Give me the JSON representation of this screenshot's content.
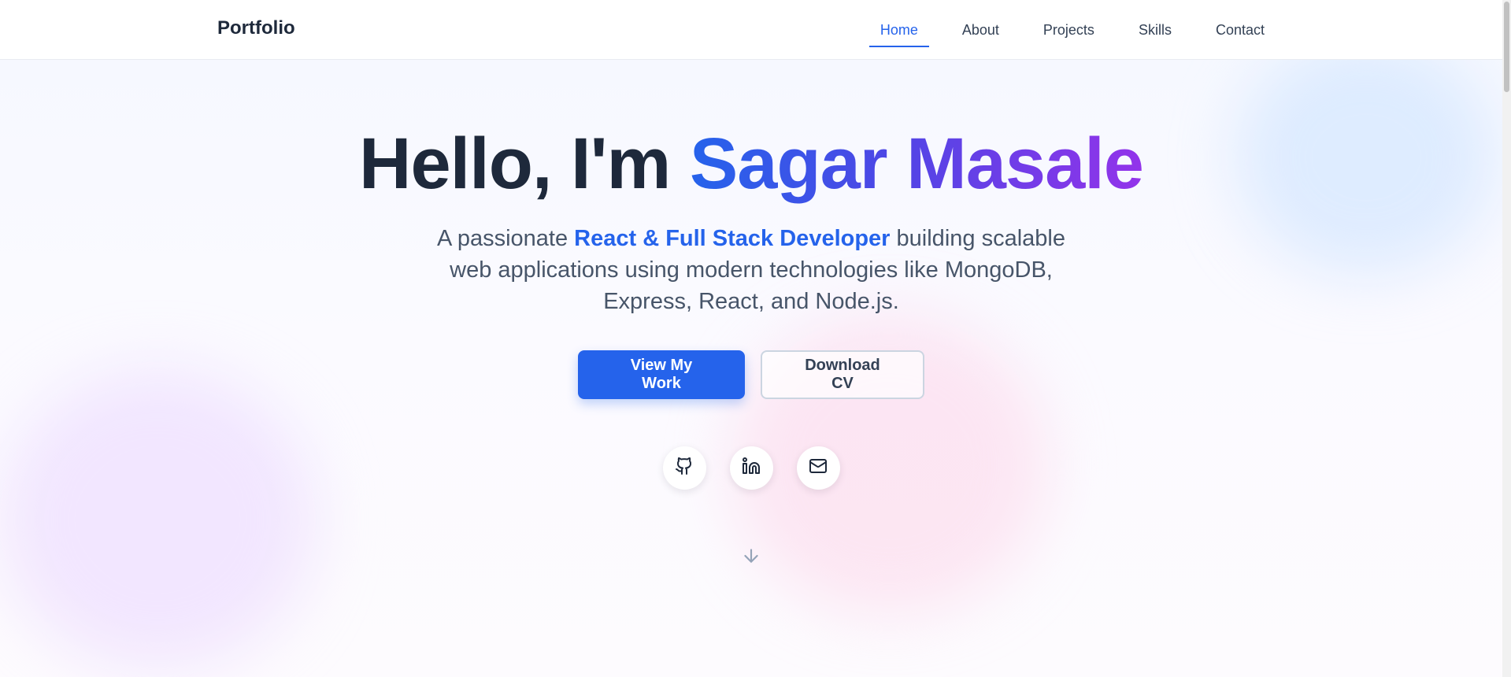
{
  "nav": {
    "brand": "Portfolio",
    "links": [
      {
        "label": "Home",
        "active": true
      },
      {
        "label": "About",
        "active": false
      },
      {
        "label": "Projects",
        "active": false
      },
      {
        "label": "Skills",
        "active": false
      },
      {
        "label": "Contact",
        "active": false
      }
    ]
  },
  "hero": {
    "greeting": "Hello, I'm ",
    "name": "Sagar Masale",
    "subtitle_prefix": "A passionate ",
    "role": "React & Full Stack Developer",
    "subtitle_suffix": " building scalable web applications using modern technologies like MongoDB, Express, React, and Node.js.",
    "primary_button": "View My Work",
    "secondary_button": "Download CV"
  },
  "socials": [
    {
      "icon": "github-icon"
    },
    {
      "icon": "linkedin-icon"
    },
    {
      "icon": "mail-icon"
    }
  ],
  "scroll_icon": "arrow-down-icon",
  "colors": {
    "accent": "#2563eb",
    "gradient_end": "#9333ea",
    "heading": "#1e293b",
    "body_text": "#475569"
  }
}
